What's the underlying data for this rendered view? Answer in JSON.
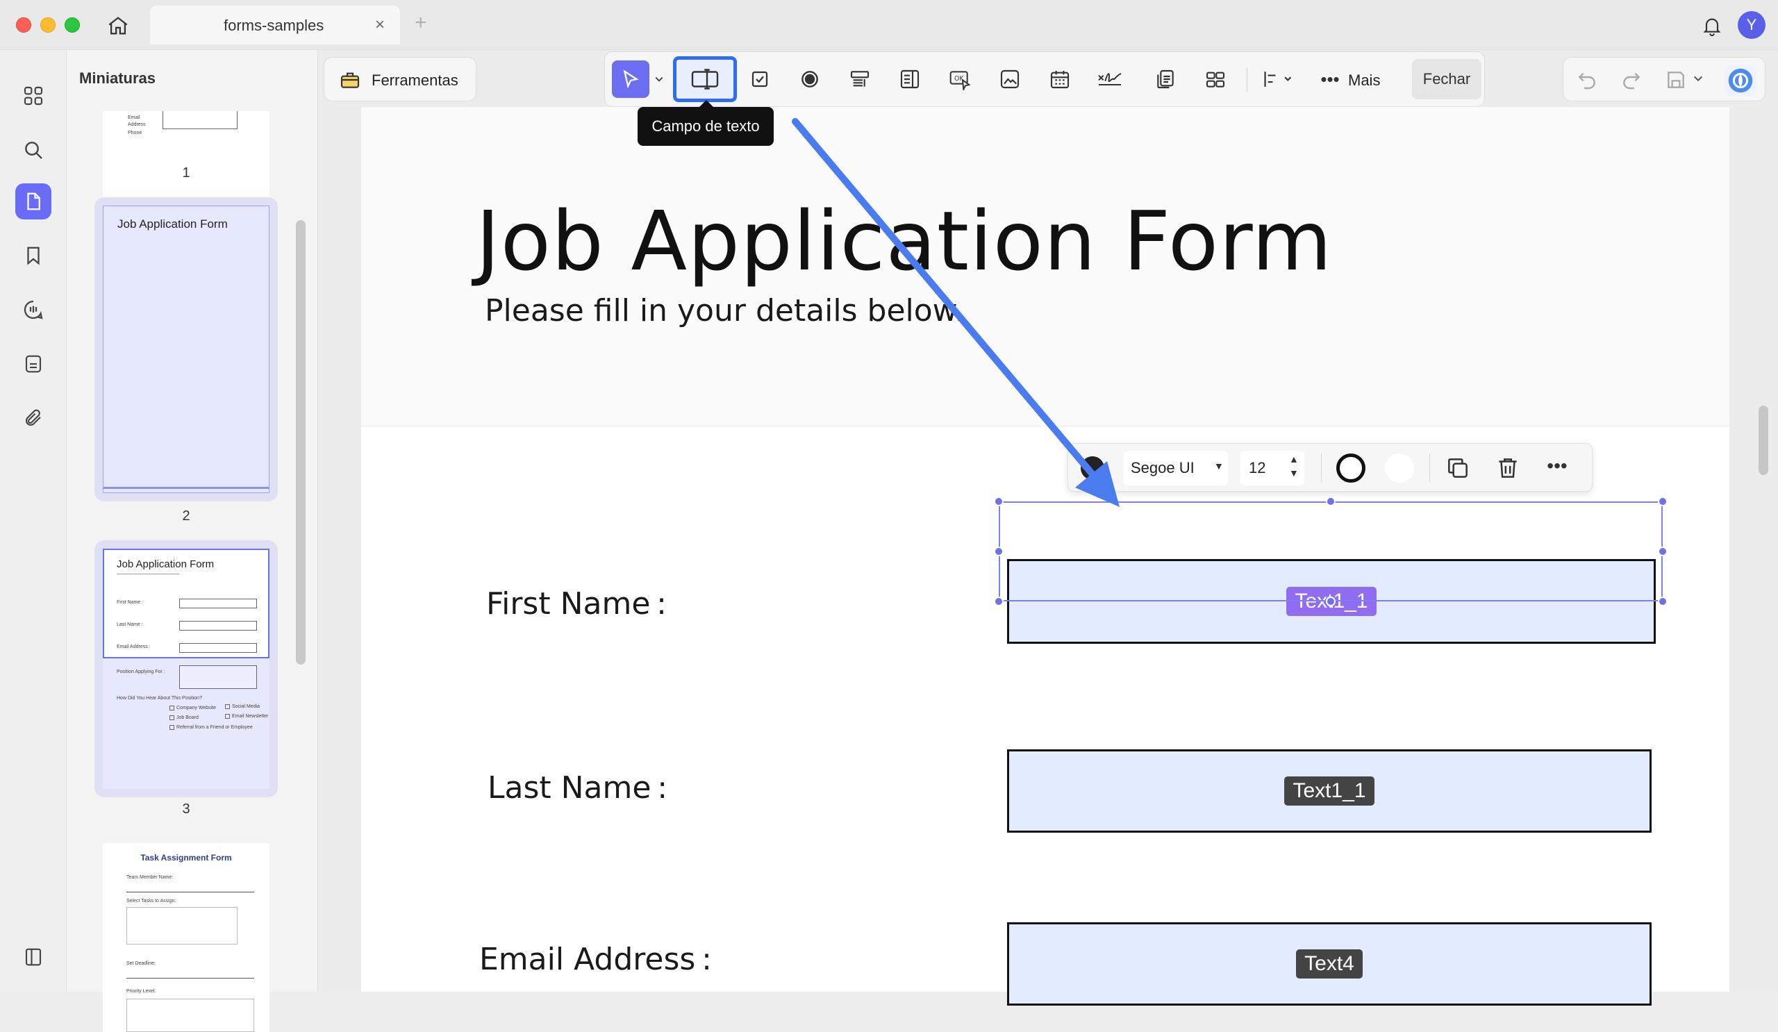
{
  "window": {
    "tab_title": "forms-samples",
    "tab_close": "×",
    "new_tab": "+",
    "avatar_letter": "Y"
  },
  "rail": {
    "icons": [
      "grid-icon",
      "search-icon",
      "pages-icon",
      "bookmark-icon",
      "comments-icon",
      "stamp-icon",
      "attachment-icon",
      "sidebar-toggle-icon"
    ]
  },
  "thumbnails": {
    "title": "Miniaturas",
    "pages": [
      {
        "number": "1"
      },
      {
        "number": "2",
        "title": "Job Application Form"
      },
      {
        "number": "3",
        "title": "Job Application Form"
      },
      {
        "number": "",
        "title": "Task Assignment Form"
      }
    ]
  },
  "toolbar": {
    "tools_label": "Ferramentas",
    "more_label": "Mais",
    "close_label": "Fechar",
    "tooltip": "Campo de texto"
  },
  "field_toolbar": {
    "font": "Segoe UI",
    "size": "12"
  },
  "document": {
    "title": "Job Application Form",
    "subtitle": "Please fill in your details below.",
    "fields": [
      {
        "label": "First Name :",
        "field_name": "Text1_1",
        "selected": true
      },
      {
        "label": "Last Name :",
        "field_name": "Text1_1",
        "selected": false
      },
      {
        "label": "Email Address :",
        "field_name": "Text4",
        "selected": false
      }
    ]
  },
  "colors": {
    "accent": "#6a6cf6",
    "tooltip_bg": "#111111",
    "annotation_arrow": "#4a7cf0",
    "field_fill": "#e3ebfe",
    "selected_tag": "#8f6cf0"
  }
}
